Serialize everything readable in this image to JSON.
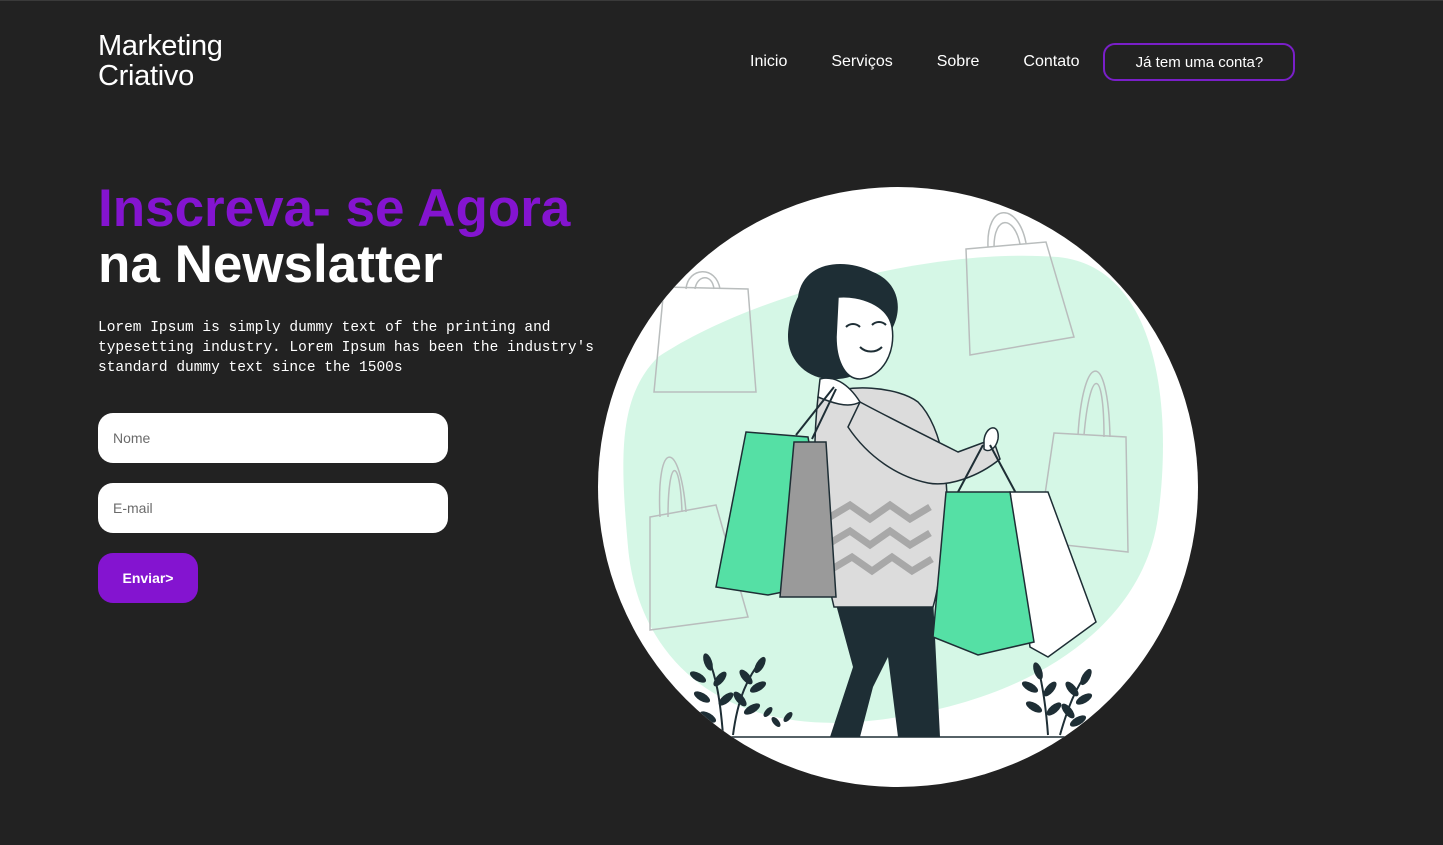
{
  "header": {
    "logo_line1": "Marketing",
    "logo_line2": "Criativo",
    "nav": {
      "home": "Inicio",
      "services": "Serviços",
      "about": "Sobre",
      "contact": "Contato"
    },
    "account_button": "Já tem uma conta?"
  },
  "hero": {
    "title_highlight": "Inscreva- se Agora",
    "title_rest": "na Newslatter",
    "description": "Lorem Ipsum is simply dummy text of the printing and typesetting industry. Lorem Ipsum has been the industry's standard dummy text since the 1500s"
  },
  "form": {
    "name_placeholder": "Nome",
    "email_placeholder": "E-mail",
    "submit_label": "Enviar>"
  },
  "colors": {
    "background": "#222222",
    "accent_purple": "#8414d0",
    "mint": "#d5f7e6",
    "green": "#55e0a5",
    "dark": "#1e2e35"
  },
  "icons": {
    "illustration": "woman-with-shopping-bags-illustration"
  }
}
